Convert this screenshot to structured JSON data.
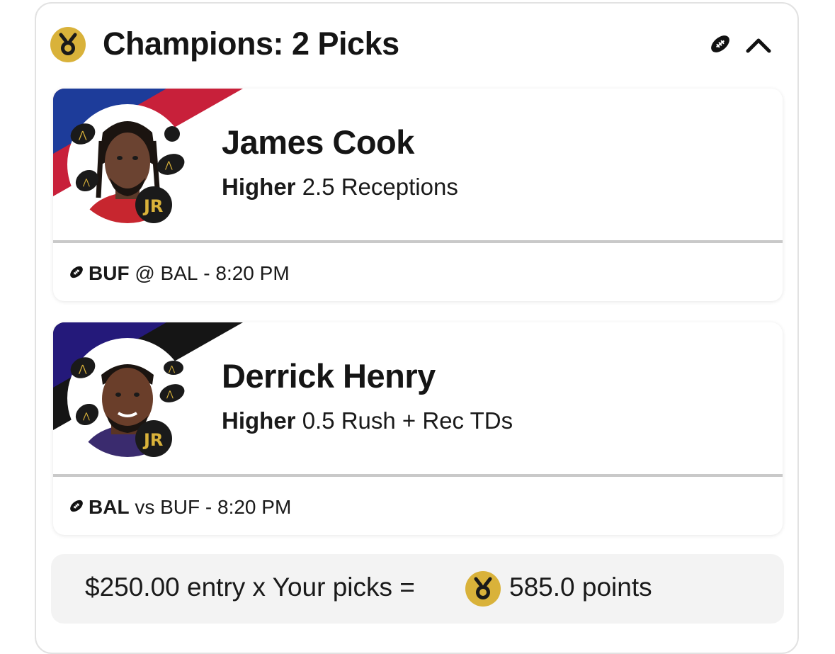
{
  "colors": {
    "medal_gold": "#D9B23A",
    "bills_blue": "#1D3C9A",
    "bills_red": "#C8203A",
    "ravens_purple": "#24197A",
    "ravens_black": "#151515",
    "divider": "#C9C9C9",
    "payout_bg": "#F3F3F3"
  },
  "header": {
    "title": "Champions: 2 Picks",
    "icons": [
      "medal-icon",
      "football-icon",
      "chevron-up-icon"
    ]
  },
  "picks": [
    {
      "player": "James Cook",
      "direction": "Higher",
      "line": "2.5 Receptions",
      "team": "BUF",
      "separator": "@",
      "opponent": "BAL",
      "time": "8:20 PM",
      "stripe_colors": [
        "#1D3C9A",
        "#C8203A"
      ]
    },
    {
      "player": "Derrick Henry",
      "direction": "Higher",
      "line": "0.5 Rush + Rec TDs",
      "team": "BAL",
      "separator": "vs",
      "opponent": "BUF",
      "time": "8:20 PM",
      "stripe_colors": [
        "#24197A",
        "#151515"
      ]
    }
  ],
  "payout": {
    "entry_text": "$250.00 entry x Your picks =",
    "points_text": "585.0 points"
  }
}
